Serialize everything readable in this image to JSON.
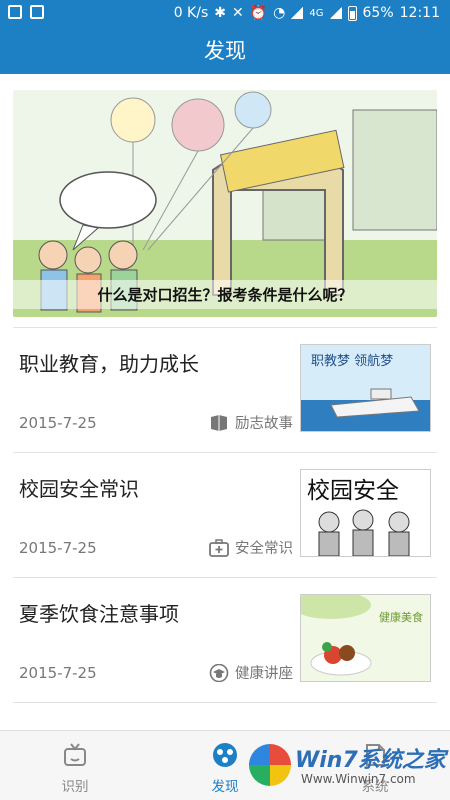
{
  "status_bar": {
    "net_speed": "0 K/s",
    "network_label": "4G",
    "battery": "65%",
    "time": "12:11"
  },
  "header": {
    "title": "发现"
  },
  "banner": {
    "caption": "什么是对口招生？报考条件是什么呢？"
  },
  "articles": [
    {
      "title": "职业教育，助力成长",
      "date": "2015-7-25",
      "tag": "励志故事",
      "tag_icon": "book-icon",
      "thumb_text": "职教梦  领航梦"
    },
    {
      "title": "校园安全常识",
      "date": "2015-7-25",
      "tag": "安全常识",
      "tag_icon": "first-aid-icon",
      "thumb_text": "校园安全"
    },
    {
      "title": "夏季饮食注意事项",
      "date": "2015-7-25",
      "tag": "健康讲座",
      "tag_icon": "graduation-cap-icon",
      "thumb_text": "健康美食"
    }
  ],
  "tabs": [
    {
      "label": "识别",
      "icon": "tv-icon",
      "active": false
    },
    {
      "label": "发现",
      "icon": "discover-icon",
      "active": true
    },
    {
      "label": "系统",
      "icon": "system-icon",
      "active": false
    }
  ],
  "watermark": {
    "title": "Win7系统之家",
    "url": "Www.Winwin7.com"
  },
  "colors": {
    "primary": "#1d7fc4",
    "text": "#222222",
    "muted": "#777777"
  }
}
